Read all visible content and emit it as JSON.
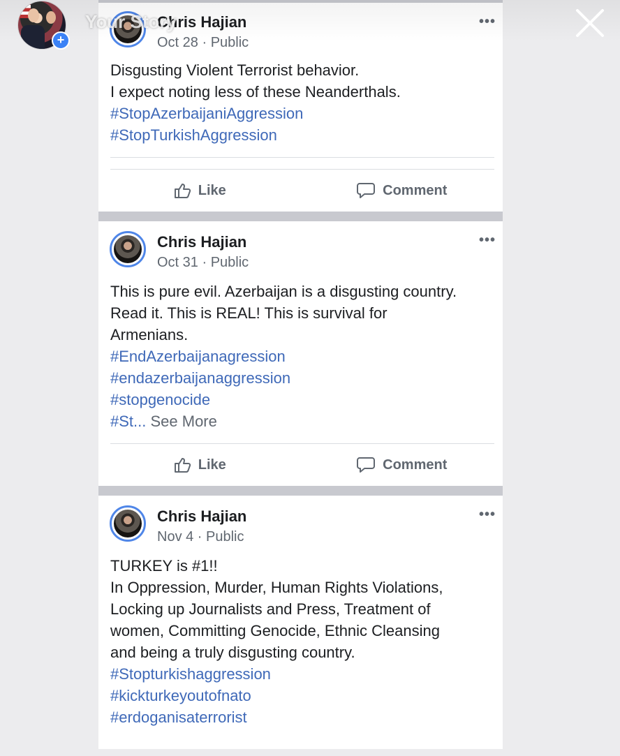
{
  "story": {
    "title": "Your Story",
    "add_icon": "+"
  },
  "posts": [
    {
      "author": "Chris Hajian",
      "date": "Oct 28",
      "privacy": "Public",
      "more": "•••",
      "lines": [
        {
          "text": "Disgusting Violent Terrorist behavior.",
          "type": "text"
        },
        {
          "text": "I expect noting less of these Neanderthals.",
          "type": "text"
        },
        {
          "text": "#StopAzerbaijaniAggression",
          "type": "hashtag"
        },
        {
          "text": "#StopTurkishAggression",
          "type": "hashtag"
        }
      ],
      "like_label": "Like",
      "comment_label": "Comment"
    },
    {
      "author": "Chris Hajian",
      "date": "Oct 31",
      "privacy": "Public",
      "more": "•••",
      "lines": [
        {
          "text": "This is pure evil. Azerbaijan is a disgusting country.",
          "type": "text"
        },
        {
          "text": "Read it. This is REAL! This is survival for",
          "type": "text"
        },
        {
          "text": "Armenians.",
          "type": "text"
        },
        {
          "text": "#EndAzerbaijanagression",
          "type": "hashtag"
        },
        {
          "text": "#endazerbaijanaggression",
          "type": "hashtag"
        },
        {
          "text": "#stopgenocide",
          "type": "hashtag"
        }
      ],
      "truncated_tag": "#St...",
      "see_more": "See More",
      "like_label": "Like",
      "comment_label": "Comment"
    },
    {
      "author": "Chris Hajian",
      "date": "Nov 4",
      "privacy": "Public",
      "more": "•••",
      "lines": [
        {
          "text": "TURKEY is #1!!",
          "type": "text"
        },
        {
          "text": "In Oppression, Murder, Human Rights Violations,",
          "type": "text"
        },
        {
          "text": "Locking up Journalists and Press, Treatment of",
          "type": "text"
        },
        {
          "text": "women, Committing Genocide, Ethnic Cleansing",
          "type": "text"
        },
        {
          "text": "and being a truly disgusting country.",
          "type": "text"
        },
        {
          "text": "#Stopturkishaggression",
          "type": "hashtag"
        },
        {
          "text": "#kickturkeyoutofnato",
          "type": "hashtag"
        },
        {
          "text": "#erdoganisaterrorist",
          "type": "hashtag"
        }
      ]
    }
  ],
  "colors": {
    "hashtag": "#3f69b8",
    "avatar_ring": "#4f86e8",
    "separator": "#c8c9cf"
  },
  "icons": {
    "like": "thumbs-up-icon",
    "comment": "speech-bubble-icon",
    "close": "close-icon",
    "more": "more-dots-icon"
  }
}
